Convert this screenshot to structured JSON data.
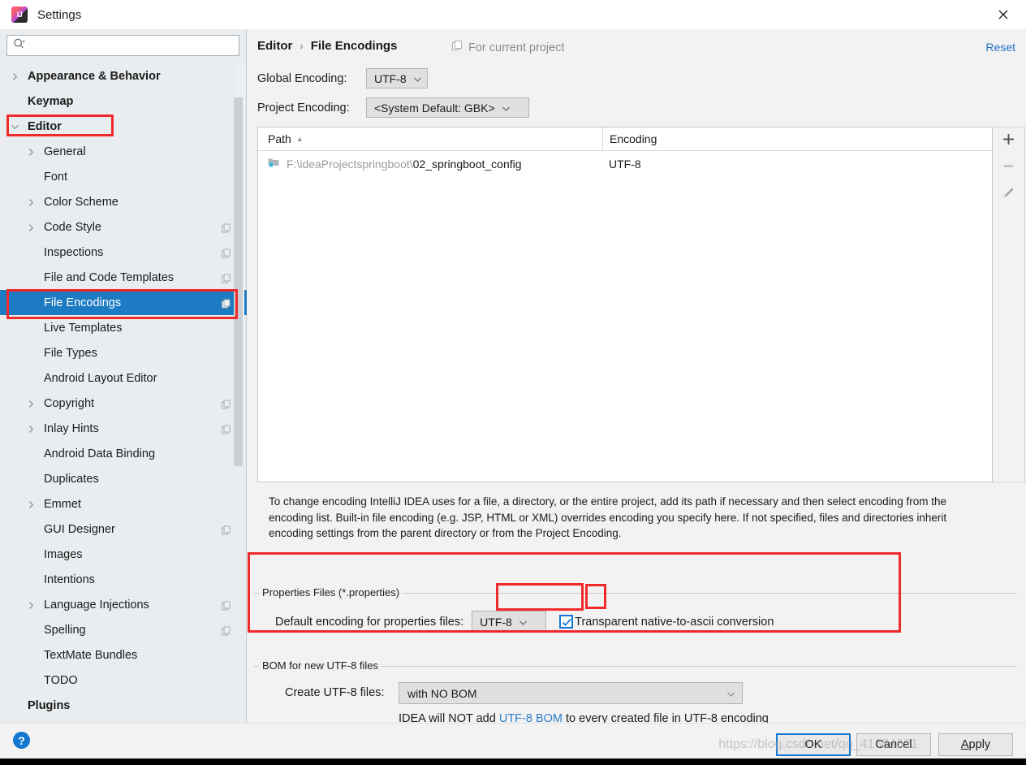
{
  "window": {
    "title": "Settings",
    "app_icon": "intellij-idea-icon",
    "close_icon": "close-icon"
  },
  "sidebar": {
    "search": {
      "value": "",
      "placeholder": "",
      "icon": "search-icon"
    },
    "items": [
      {
        "label": "Appearance & Behavior",
        "indent": 34,
        "arrow": "chevron-right",
        "bold": true,
        "badge": false,
        "selected": false
      },
      {
        "label": "Keymap",
        "indent": 34,
        "arrow": "none",
        "bold": true,
        "badge": false,
        "selected": false
      },
      {
        "label": "Editor",
        "indent": 34,
        "arrow": "chevron-down",
        "bold": true,
        "badge": false,
        "selected": false
      },
      {
        "label": "General",
        "indent": 54,
        "arrow": "chevron-right",
        "bold": false,
        "badge": false,
        "selected": false
      },
      {
        "label": "Font",
        "indent": 54,
        "arrow": "none",
        "bold": false,
        "badge": false,
        "selected": false
      },
      {
        "label": "Color Scheme",
        "indent": 54,
        "arrow": "chevron-right",
        "bold": false,
        "badge": false,
        "selected": false
      },
      {
        "label": "Code Style",
        "indent": 54,
        "arrow": "chevron-right",
        "bold": false,
        "badge": true,
        "selected": false
      },
      {
        "label": "Inspections",
        "indent": 54,
        "arrow": "none",
        "bold": false,
        "badge": true,
        "selected": false
      },
      {
        "label": "File and Code Templates",
        "indent": 54,
        "arrow": "none",
        "bold": false,
        "badge": true,
        "selected": false
      },
      {
        "label": "File Encodings",
        "indent": 54,
        "arrow": "none",
        "bold": false,
        "badge": true,
        "selected": true
      },
      {
        "label": "Live Templates",
        "indent": 54,
        "arrow": "none",
        "bold": false,
        "badge": false,
        "selected": false
      },
      {
        "label": "File Types",
        "indent": 54,
        "arrow": "none",
        "bold": false,
        "badge": false,
        "selected": false
      },
      {
        "label": "Android Layout Editor",
        "indent": 54,
        "arrow": "none",
        "bold": false,
        "badge": false,
        "selected": false
      },
      {
        "label": "Copyright",
        "indent": 54,
        "arrow": "chevron-right",
        "bold": false,
        "badge": true,
        "selected": false
      },
      {
        "label": "Inlay Hints",
        "indent": 54,
        "arrow": "chevron-right",
        "bold": false,
        "badge": true,
        "selected": false
      },
      {
        "label": "Android Data Binding",
        "indent": 54,
        "arrow": "none",
        "bold": false,
        "badge": false,
        "selected": false
      },
      {
        "label": "Duplicates",
        "indent": 54,
        "arrow": "none",
        "bold": false,
        "badge": false,
        "selected": false
      },
      {
        "label": "Emmet",
        "indent": 54,
        "arrow": "chevron-right",
        "bold": false,
        "badge": false,
        "selected": false
      },
      {
        "label": "GUI Designer",
        "indent": 54,
        "arrow": "none",
        "bold": false,
        "badge": true,
        "selected": false
      },
      {
        "label": "Images",
        "indent": 54,
        "arrow": "none",
        "bold": false,
        "badge": false,
        "selected": false
      },
      {
        "label": "Intentions",
        "indent": 54,
        "arrow": "none",
        "bold": false,
        "badge": false,
        "selected": false
      },
      {
        "label": "Language Injections",
        "indent": 54,
        "arrow": "chevron-right",
        "bold": false,
        "badge": true,
        "selected": false
      },
      {
        "label": "Spelling",
        "indent": 54,
        "arrow": "none",
        "bold": false,
        "badge": true,
        "selected": false
      },
      {
        "label": "TextMate Bundles",
        "indent": 54,
        "arrow": "none",
        "bold": false,
        "badge": false,
        "selected": false
      },
      {
        "label": "TODO",
        "indent": 54,
        "arrow": "none",
        "bold": false,
        "badge": false,
        "selected": false
      },
      {
        "label": "Plugins",
        "indent": 34,
        "arrow": "none",
        "bold": true,
        "badge": false,
        "selected": false
      }
    ]
  },
  "header": {
    "crumb_parent": "Editor",
    "crumb_sep": "›",
    "crumb_current": "File Encodings",
    "for_current_project": "For current project",
    "for_current_project_icon": "copy-scope-icon",
    "reset_label": "Reset"
  },
  "encodings": {
    "global_label": "Global Encoding:",
    "global_value": "UTF-8",
    "project_label": "Project Encoding:",
    "project_value": "<System Default: GBK>"
  },
  "table": {
    "columns": [
      "Path",
      "Encoding"
    ],
    "sort_indicator": "▲",
    "rows": [
      {
        "icon": "folder-icon",
        "path_prefix": "F:\\ideaProjectspringboot\\",
        "path_name": "02_springboot_config",
        "encoding": "UTF-8"
      }
    ],
    "toolbar": [
      {
        "name": "add-path-button",
        "icon": "plus-icon"
      },
      {
        "name": "remove-path-button",
        "icon": "minus-icon"
      },
      {
        "name": "edit-path-button",
        "icon": "pencil-icon"
      }
    ]
  },
  "description": "To change encoding IntelliJ IDEA uses for a file, a directory, or the entire project, add its path if necessary and then select encoding from the encoding list. Built-in file encoding (e.g. JSP, HTML or XML) overrides encoding you specify here. If not specified, files and directories inherit encoding settings from the parent directory or from the Project Encoding.",
  "properties_group": {
    "title": "Properties Files (*.properties)",
    "default_encoding_label": "Default encoding for properties files:",
    "default_encoding_value": "UTF-8",
    "transparent_checkbox_label": "Transparent native-to-ascii conversion",
    "transparent_checked": true
  },
  "bom_group": {
    "title": "BOM for new UTF-8 files",
    "create_label": "Create UTF-8 files:",
    "create_value": "with NO BOM",
    "note_before": "IDEA will NOT add ",
    "note_link": "UTF-8 BOM",
    "note_after": " to every created file in UTF-8 encoding"
  },
  "footer": {
    "help_label": "?",
    "ok_label": "OK",
    "cancel_label": "Cancel",
    "apply_label": "Apply"
  },
  "watermark": "https://blog.csdn.net/qq_41684621",
  "colors": {
    "accent_blue": "#1d7bc4",
    "link_blue": "#2470c4",
    "annotation_red": "#f02a2a",
    "sidebar_bg": "#e9edf0",
    "content_bg": "#f2f2f2"
  }
}
